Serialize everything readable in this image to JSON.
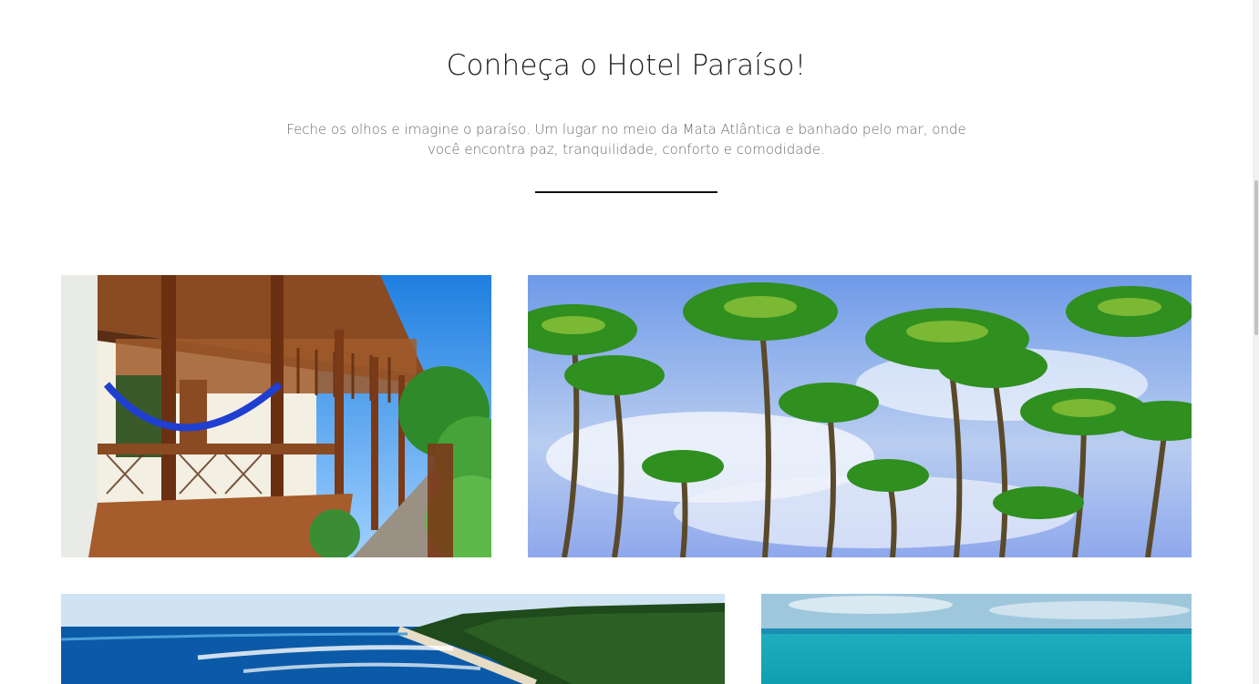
{
  "section": {
    "title": "Conheça o Hotel Paraíso!",
    "description": "Feche os olhos e imagine o paraíso. Um lugar no meio da Mata Atlântica e banhado pelo mar, onde você encontra paz, tranquilidade, conforto e comodidade."
  },
  "gallery": [
    {
      "name": "hotel-veranda-hammocks-photo"
    },
    {
      "name": "palm-trees-photo"
    },
    {
      "name": "beach-coastline-photo"
    },
    {
      "name": "turquoise-sea-photo"
    }
  ],
  "colors": {
    "title": "#1b1b1b",
    "description": "#6b6b6b",
    "divider": "#111111",
    "background": "#ffffff"
  }
}
